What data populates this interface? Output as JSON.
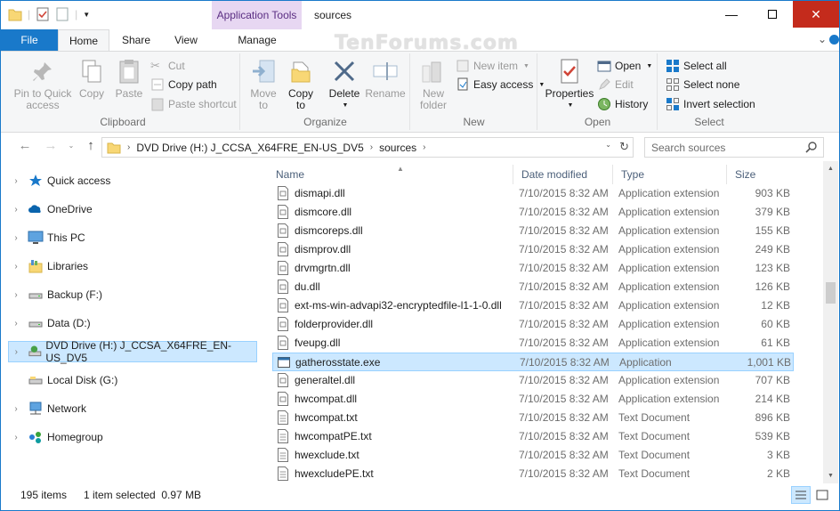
{
  "titlebar": {
    "contextual_tab": "Application Tools",
    "title": "sources",
    "minimize": "—",
    "maximize": "☐",
    "close": "✕"
  },
  "tabs": {
    "file": "File",
    "home": "Home",
    "share": "Share",
    "view": "View",
    "manage": "Manage"
  },
  "watermark": "TenForums.com",
  "ribbon": {
    "clipboard": {
      "label": "Clipboard",
      "pin": [
        "Pin to Quick",
        "access"
      ],
      "copy": "Copy",
      "paste": "Paste",
      "cut": "Cut",
      "copy_path": "Copy path",
      "paste_shortcut": "Paste shortcut"
    },
    "organize": {
      "label": "Organize",
      "move_to": [
        "Move",
        "to"
      ],
      "copy_to": [
        "Copy",
        "to"
      ],
      "delete": "Delete",
      "rename": "Rename"
    },
    "new": {
      "label": "New",
      "new_folder": [
        "New",
        "folder"
      ],
      "new_item": "New item",
      "easy_access": "Easy access"
    },
    "open": {
      "label": "Open",
      "properties": "Properties",
      "open": "Open",
      "edit": "Edit",
      "history": "History"
    },
    "select": {
      "label": "Select",
      "select_all": "Select all",
      "select_none": "Select none",
      "invert_selection": "Invert selection"
    }
  },
  "address": {
    "crumbs": [
      "DVD Drive (H:) J_CCSA_X64FRE_EN-US_DV5",
      "sources"
    ],
    "search_placeholder": "Search sources"
  },
  "navpane": {
    "items": [
      {
        "label": "Quick access",
        "icon": "star-icon"
      },
      {
        "label": "OneDrive",
        "icon": "cloud-icon"
      },
      {
        "label": "This PC",
        "icon": "monitor-icon"
      },
      {
        "label": "Libraries",
        "icon": "libraries-icon"
      },
      {
        "label": "Backup (F:)",
        "icon": "drive-icon"
      },
      {
        "label": "Data (D:)",
        "icon": "drive-icon"
      },
      {
        "label": "DVD Drive (H:) J_CCSA_X64FRE_EN-US_DV5",
        "icon": "dvd-icon"
      },
      {
        "label": "Local Disk (G:)",
        "icon": "drive-icon"
      },
      {
        "label": "Network",
        "icon": "network-icon"
      },
      {
        "label": "Homegroup",
        "icon": "homegroup-icon"
      }
    ]
  },
  "columns": {
    "name": "Name",
    "date": "Date modified",
    "type": "Type",
    "size": "Size"
  },
  "files": [
    {
      "name": "dismapi.dll",
      "date": "7/10/2015 8:32 AM",
      "type": "Application extension",
      "size": "903 KB"
    },
    {
      "name": "dismcore.dll",
      "date": "7/10/2015 8:32 AM",
      "type": "Application extension",
      "size": "379 KB"
    },
    {
      "name": "dismcoreps.dll",
      "date": "7/10/2015 8:32 AM",
      "type": "Application extension",
      "size": "155 KB"
    },
    {
      "name": "dismprov.dll",
      "date": "7/10/2015 8:32 AM",
      "type": "Application extension",
      "size": "249 KB"
    },
    {
      "name": "drvmgrtn.dll",
      "date": "7/10/2015 8:32 AM",
      "type": "Application extension",
      "size": "123 KB"
    },
    {
      "name": "du.dll",
      "date": "7/10/2015 8:32 AM",
      "type": "Application extension",
      "size": "126 KB"
    },
    {
      "name": "ext-ms-win-advapi32-encryptedfile-l1-1-0.dll",
      "date": "7/10/2015 8:32 AM",
      "type": "Application extension",
      "size": "12 KB"
    },
    {
      "name": "folderprovider.dll",
      "date": "7/10/2015 8:32 AM",
      "type": "Application extension",
      "size": "60 KB"
    },
    {
      "name": "fveupg.dll",
      "date": "7/10/2015 8:32 AM",
      "type": "Application extension",
      "size": "61 KB"
    },
    {
      "name": "gatherosstate.exe",
      "date": "7/10/2015 8:32 AM",
      "type": "Application",
      "size": "1,001 KB"
    },
    {
      "name": "generaltel.dll",
      "date": "7/10/2015 8:32 AM",
      "type": "Application extension",
      "size": "707 KB"
    },
    {
      "name": "hwcompat.dll",
      "date": "7/10/2015 8:32 AM",
      "type": "Application extension",
      "size": "214 KB"
    },
    {
      "name": "hwcompat.txt",
      "date": "7/10/2015 8:32 AM",
      "type": "Text Document",
      "size": "896 KB"
    },
    {
      "name": "hwcompatPE.txt",
      "date": "7/10/2015 8:32 AM",
      "type": "Text Document",
      "size": "539 KB"
    },
    {
      "name": "hwexclude.txt",
      "date": "7/10/2015 8:32 AM",
      "type": "Text Document",
      "size": "3 KB"
    },
    {
      "name": "hwexcludePE.txt",
      "date": "7/10/2015 8:32 AM",
      "type": "Text Document",
      "size": "2 KB"
    }
  ],
  "status": {
    "count": "195 items",
    "selection": "1 item selected  0.97 MB"
  },
  "colors": {
    "accent": "#1979ca",
    "selection": "#cce8ff",
    "selection_border": "#99d1ff",
    "context_tab": "#e7d7f2"
  }
}
